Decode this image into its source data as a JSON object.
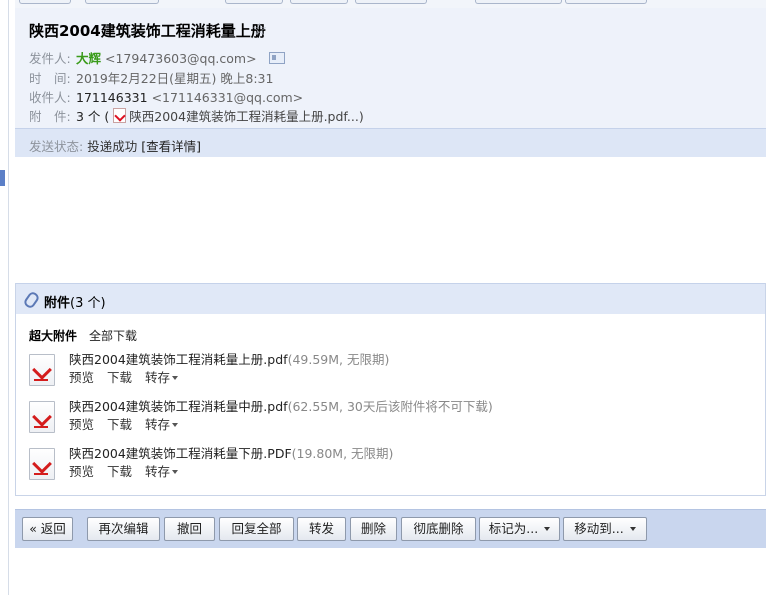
{
  "email": {
    "subject": "陕西2004建筑装饰工程消耗量上册",
    "sender_label": "发件人:",
    "sender_name": "大辉",
    "sender_email": "<179473603@qq.com>",
    "time_label": "时　间:",
    "time_value": "2019年2月22日(星期五) 晚上8:31",
    "recipient_label": "收件人:",
    "recipient_name": "171146331",
    "recipient_email": "<171146331@qq.com>",
    "attachment_label": "附　件:",
    "attachment_count": "3 个 (",
    "attachment_preview": "陕西2004建筑装饰工程消耗量上册.pdf...)",
    "status_label": "发送状态:",
    "status_value": "投递成功",
    "status_link": "[查看详情]"
  },
  "attachments": {
    "header_title": "附件",
    "header_count": "(3 个)",
    "section_label": "超大附件",
    "download_all": "全部下载",
    "files": [
      {
        "name": "陕西2004建筑装饰工程消耗量上册.pdf",
        "meta": "(49.59M, 无限期)"
      },
      {
        "name": "陕西2004建筑装饰工程消耗量中册.pdf",
        "meta": "(62.55M, 30天后该附件将不可下载)"
      },
      {
        "name": "陕西2004建筑装饰工程消耗量下册.PDF",
        "meta": "(19.80M, 无限期)"
      }
    ],
    "action_preview": "预览",
    "action_download": "下载",
    "action_forward": "转存"
  },
  "toolbar": {
    "back": "« 返回",
    "reedit": "再次编辑",
    "recall": "撤回",
    "reply_all": "回复全部",
    "forward": "转发",
    "delete": "删除",
    "delete_forever": "彻底删除",
    "mark_as": "标记为...",
    "move_to": "移动到..."
  },
  "colors": {
    "header_bg": "#eef2fa",
    "bar_bg": "#dde6f6",
    "toolbar_bg": "#c9d6ee",
    "sender_green": "#3a9b1a"
  }
}
